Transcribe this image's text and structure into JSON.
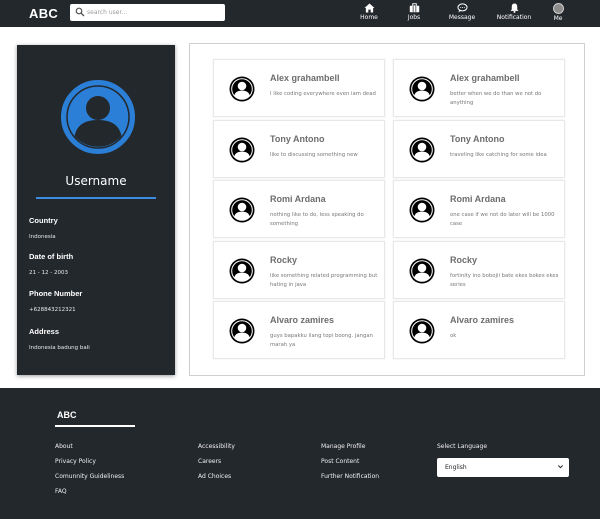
{
  "nav": {
    "brand": "ABC",
    "search_placeholder": "search user...",
    "items": [
      {
        "label": "Home",
        "icon": "home-icon"
      },
      {
        "label": "Jobs",
        "icon": "briefcase-icon"
      },
      {
        "label": "Message",
        "icon": "chat-icon"
      },
      {
        "label": "Notification",
        "icon": "bell-icon"
      },
      {
        "label": "Me",
        "icon": "avatar"
      }
    ]
  },
  "profile": {
    "username": "Username",
    "fields": [
      {
        "label": "Country",
        "value": "Indonesia"
      },
      {
        "label": "Date of birth",
        "value": "21 - 12 - 2003"
      },
      {
        "label": "Phone Number",
        "value": "+628843212321"
      },
      {
        "label": "Address",
        "value": "Indonesia badung bali"
      }
    ],
    "accent_color": "#3d8be0"
  },
  "friends": [
    {
      "name": "Alex grahambell",
      "desc": "I like coding everywhere even iam dead"
    },
    {
      "name": "Alex grahambell",
      "desc": "better when we do than we not do anything"
    },
    {
      "name": "Tony Antono",
      "desc": "like to discussing something new"
    },
    {
      "name": "Tony Antono",
      "desc": "traveling like catching for some idea"
    },
    {
      "name": "Romi Ardana",
      "desc": "nothing like to do, less speaking do something"
    },
    {
      "name": "Romi Ardana",
      "desc": "one case if we not do later will be 1000 case"
    },
    {
      "name": "Rocky",
      "desc": "like something related programming but hating in java"
    },
    {
      "name": "Rocky",
      "desc": "fortinity ino bobojii bate ekes bokes ekes series"
    },
    {
      "name": "Alvaro zamires",
      "desc": "guys bapakku ilang topi boong. jangan marah ya"
    },
    {
      "name": "Alvaro zamires",
      "desc": "ok"
    }
  ],
  "footer": {
    "brand": "ABC",
    "col1": [
      "About",
      "Privacy Policy",
      "Comunnity Guideliness",
      "FAQ"
    ],
    "col2": [
      "Accessibility",
      "Careers",
      "Ad Choices"
    ],
    "col3": [
      "Manage Profile",
      "Post Content",
      "Further Notification"
    ],
    "language_label": "Select Language",
    "language_selected": "English"
  },
  "colors": {
    "dark": "#23282d",
    "accent": "#3d8be0"
  }
}
